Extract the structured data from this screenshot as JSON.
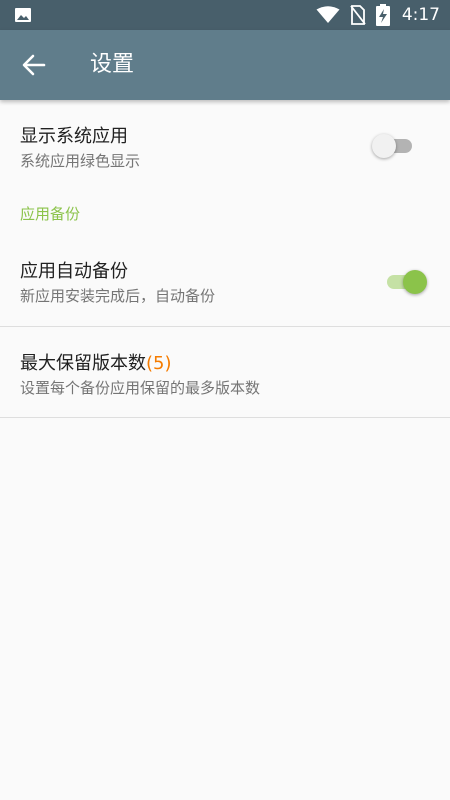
{
  "status_bar": {
    "time": "4:17",
    "icons": [
      "image-icon",
      "wifi-icon",
      "no-sim-icon",
      "battery-charging-icon"
    ]
  },
  "app_bar": {
    "back_icon": "arrow-left-icon",
    "title": "设置"
  },
  "settings": {
    "show_system_apps": {
      "title": "显示系统应用",
      "summary": "系统应用绿色显示",
      "enabled": false
    },
    "category_backup": "应用备份",
    "auto_backup": {
      "title": "应用自动备份",
      "summary": "新应用安装完成后，自动备份",
      "enabled": true
    },
    "max_versions": {
      "title": "最大保留版本数",
      "count": "(5)",
      "summary": "设置每个备份应用保留的最多版本数"
    }
  },
  "colors": {
    "status_bar": "#485f6b",
    "app_bar": "#607d8b",
    "accent_green": "#8bc34a",
    "count_orange": "#f57c00"
  }
}
